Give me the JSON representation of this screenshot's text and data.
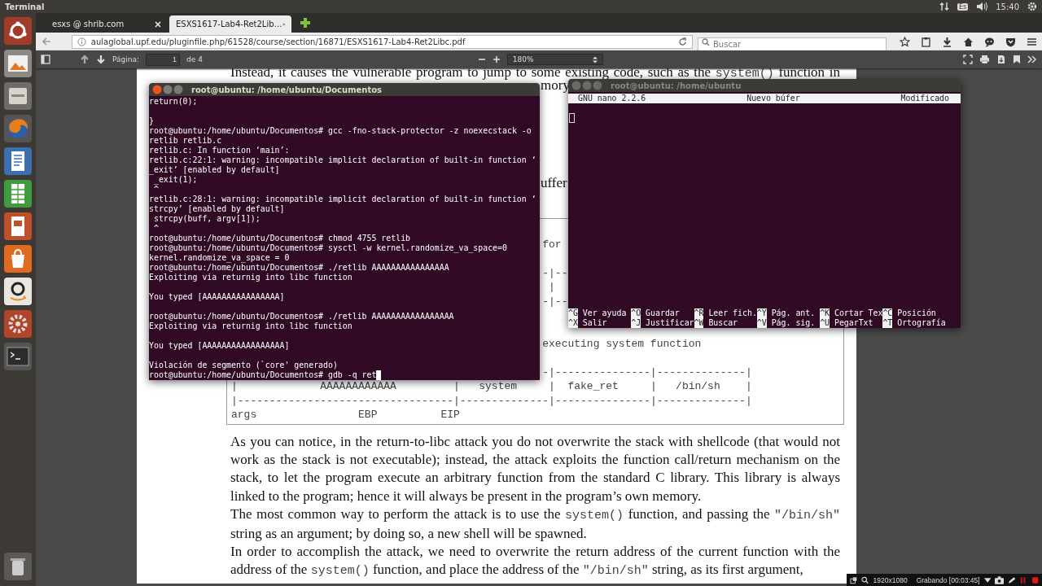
{
  "top_panel": {
    "app_name": "Terminal",
    "keyboard_layout": "Es",
    "time": "15:40"
  },
  "browser": {
    "tabs": [
      {
        "title": "esxs @ shrib.com",
        "selected": false
      },
      {
        "title": "ESXS1617-Lab4-Ret2Lib…",
        "selected": true
      }
    ],
    "url": "aulaglobal.upf.edu/pluginfile.php/61528/course/section/16871/ESXS1617-Lab4-Ret2Libc.pdf",
    "search": {
      "placeholder": "Buscar"
    },
    "pdf_toolbar": {
      "page_label": "Página:",
      "page": "1",
      "page_count": "de 4",
      "zoom": "180%"
    }
  },
  "document": {
    "top_line": [
      {
        "kind": "text",
        "text": "Instead, it causes the vulnerable program to jump to some existing code, such as the "
      },
      {
        "kind": "code",
        "text": "system()"
      },
      {
        "kind": "text",
        "text": " function in"
      }
    ],
    "fragments": [
      "mory",
      "uffer"
    ],
    "diagram_lines": [
      "for",
      "-|--",
      "|",
      "-|--",
      "executing system function",
      "-|---------------|--------------|",
      "|             AAAAAAAAAAAA         |   system     |  fake_ret     |   /bin/sh    |",
      "|----------------------------------|--------------|---------------|--------------|",
      "args                EBP          EIP"
    ],
    "paragraphs": [
      [
        {
          "kind": "text",
          "text": "As you can notice, in the return-to-libc attack you do not overwrite the stack with shellcode (that would not work as the stack is not executable); instead, the attack exploits the function call/return mechanism on the stack, to let the program execute an arbitrary function from the standard C library.  This library is always linked to the program; hence it will always be present in the program’s own memory."
        }
      ],
      [
        {
          "kind": "text",
          "text": "The most common way to perform the attack is to use the "
        },
        {
          "kind": "code",
          "text": "system()"
        },
        {
          "kind": "text",
          "text": " function, and passing the "
        },
        {
          "kind": "code",
          "text": "\"/bin/sh\""
        },
        {
          "kind": "text",
          "text": " string as an argument; by doing so, a new shell will be spawned."
        }
      ],
      [
        {
          "kind": "text",
          "text": "In order to accomplish the attack, we need to overwrite the return address of the current function with the address of the "
        },
        {
          "kind": "code",
          "text": "system()"
        },
        {
          "kind": "text",
          "text": " function, and place the address of the "
        },
        {
          "kind": "code",
          "text": "\"/bin/sh\""
        },
        {
          "kind": "text",
          "text": " string, as its first argument,"
        }
      ]
    ]
  },
  "terminal": {
    "title": "root@ubuntu: /home/ubuntu/Documentos",
    "active": true,
    "blocks": [
      [
        "return(0);"
      ],
      [
        "}",
        "root@ubuntu:/home/ubuntu/Documentos# gcc -fno-stack-protector -z noexecstack -o",
        "retlib retlib.c",
        "retlib.c: In function ‘main’:",
        "retlib.c:22:1: warning: incompatible implicit declaration of built-in function ‘",
        "_exit’ [enabled by default]",
        " _exit(1);",
        " ^",
        "retlib.c:28:1: warning: incompatible implicit declaration of built-in function ‘",
        "strcpy’ [enabled by default]",
        " strcpy(buff, argv[1]);",
        " ^",
        "root@ubuntu:/home/ubuntu/Documentos# chmod 4755 retlib",
        "root@ubuntu:/home/ubuntu/Documentos# sysctl -w kernel.randomize_va_space=0",
        "kernel.randomize_va_space = 0",
        "root@ubuntu:/home/ubuntu/Documentos# ./retlib AAAAAAAAAAAAAAAA",
        "Exploiting via returnig into libc function"
      ],
      [
        "You typed [AAAAAAAAAAAAAAAA]"
      ],
      [
        "root@ubuntu:/home/ubuntu/Documentos# ./retlib AAAAAAAAAAAAAAAAA",
        "Exploiting via returnig into libc function"
      ],
      [
        "You typed [AAAAAAAAAAAAAAAAA]"
      ],
      [
        "Violación de segmento (`core' generado)",
        "root@ubuntu:/home/ubuntu/Documentos# gdb -q ret"
      ]
    ]
  },
  "nano": {
    "title": "root@ubuntu: /home/ubuntu",
    "active": false,
    "version": "GNU nano 2.2.6",
    "buffer": "Nuevo búfer",
    "status": "Modificado",
    "shortcut_rows": [
      [
        {
          "key": "^G",
          "label": "Ver ayuda"
        },
        {
          "key": "^O",
          "label": "Guardar"
        },
        {
          "key": "^R",
          "label": "Leer fich."
        },
        {
          "key": "^Y",
          "label": "Pág. ant."
        },
        {
          "key": "^K",
          "label": "Cortar Tex"
        },
        {
          "key": "^C",
          "label": "Posición"
        }
      ],
      [
        {
          "key": "^X",
          "label": "Salir"
        },
        {
          "key": "^J",
          "label": "Justificar"
        },
        {
          "key": "^W",
          "label": "Buscar"
        },
        {
          "key": "^V",
          "label": "Pág. sig."
        },
        {
          "key": "^U",
          "label": "PegarTxt"
        },
        {
          "key": "^T",
          "label": "Ortografía"
        }
      ]
    ]
  },
  "recorder": {
    "resolution": "1920x1080",
    "status": "Grabando [00:03:45]"
  }
}
